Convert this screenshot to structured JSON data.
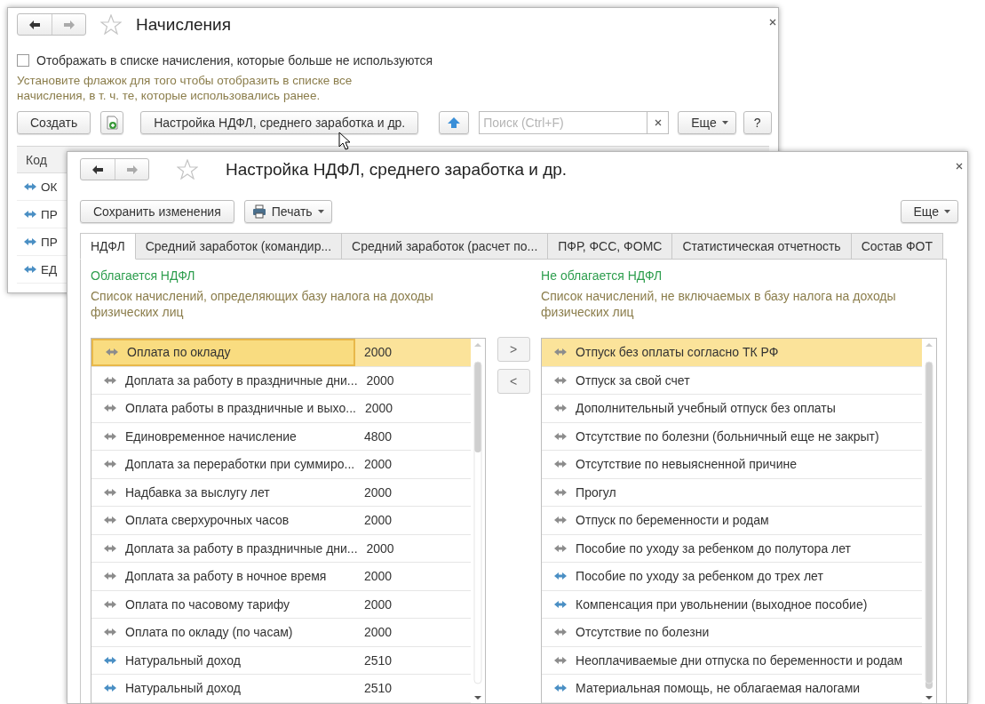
{
  "back_window": {
    "title": "Начисления",
    "show_unused": {
      "label": "Отображать в списке начисления, которые больше не используются",
      "checked": false
    },
    "hint": "Установите флажок для того чтобы отобразить в списке все начисления, в т. ч. те, которые использовались ранее.",
    "create_button": "Создать",
    "settings_button": "Настройка НДФЛ, среднего заработка и др.",
    "search": {
      "placeholder": "Поиск (Ctrl+F)"
    },
    "more_button": "Еще",
    "help_button": "?",
    "list": {
      "columns": [
        "Код"
      ],
      "rows": [
        {
          "code": "ОК",
          "color": "#4a8fc4"
        },
        {
          "code": "ПР",
          "color": "#4a8fc4"
        },
        {
          "code": "ПР",
          "color": "#4a8fc4"
        },
        {
          "code": "ЕД",
          "color": "#4a8fc4"
        }
      ]
    }
  },
  "settings_window": {
    "title": "Настройка НДФЛ, среднего заработка и др.",
    "save_button": "Сохранить изменения",
    "print_button": "Печать",
    "more_button": "Еще",
    "tabs": [
      {
        "label": "НДФЛ",
        "selected": true
      },
      {
        "label": "Средний заработок (командир...",
        "selected": false
      },
      {
        "label": "Средний заработок (расчет по...",
        "selected": false
      },
      {
        "label": "ПФР, ФСС, ФОМС",
        "selected": false
      },
      {
        "label": "Статистическая отчетность",
        "selected": false
      },
      {
        "label": "Состав ФОТ",
        "selected": false
      }
    ],
    "taxed": {
      "heading": "Облагается НДФЛ",
      "description": "Список начислений, определяющих базу налога на доходы физических лиц",
      "rows": [
        {
          "name": "Оплата по окладу",
          "amount": "2000",
          "color": "#8c8c8c",
          "selected": true
        },
        {
          "name": "Доплата за работу в праздничные дни...",
          "amount": "2000",
          "color": "#8c8c8c",
          "selected": false
        },
        {
          "name": "Оплата работы в праздничные и выхо...",
          "amount": "2000",
          "color": "#8c8c8c",
          "selected": false
        },
        {
          "name": "Единовременное начисление",
          "amount": "4800",
          "color": "#8c8c8c",
          "selected": false
        },
        {
          "name": "Доплата за переработки при суммиро...",
          "amount": "2000",
          "color": "#8c8c8c",
          "selected": false
        },
        {
          "name": "Надбавка за выслугу лет",
          "amount": "2000",
          "color": "#8c8c8c",
          "selected": false
        },
        {
          "name": "Оплата сверхурочных часов",
          "amount": "2000",
          "color": "#8c8c8c",
          "selected": false
        },
        {
          "name": "Доплата за работу в праздничные дни...",
          "amount": "2000",
          "color": "#8c8c8c",
          "selected": false
        },
        {
          "name": "Доплата за работу в ночное время",
          "amount": "2000",
          "color": "#8c8c8c",
          "selected": false
        },
        {
          "name": "Оплата по часовому тарифу",
          "amount": "2000",
          "color": "#8c8c8c",
          "selected": false
        },
        {
          "name": "Оплата по окладу (по часам)",
          "amount": "2000",
          "color": "#8c8c8c",
          "selected": false
        },
        {
          "name": "Натуральный доход",
          "amount": "2510",
          "color": "#4a8fc4",
          "selected": false
        },
        {
          "name": "Натуральный доход",
          "amount": "2510",
          "color": "#4a8fc4",
          "selected": false
        }
      ]
    },
    "move_buttons": [
      ">",
      "<"
    ],
    "untaxed": {
      "heading": "Не облагается НДФЛ",
      "description": "Список начислений, не включаемых в базу налога на доходы физических лиц",
      "rows": [
        {
          "name": "Отпуск без оплаты согласно ТК РФ",
          "color": "#8c8c8c",
          "selected": true
        },
        {
          "name": "Отпуск за свой счет",
          "color": "#8c8c8c",
          "selected": false
        },
        {
          "name": "Дополнительный учебный отпуск без оплаты",
          "color": "#8c8c8c",
          "selected": false
        },
        {
          "name": "Отсутствие по болезни (больничный еще не закрыт)",
          "color": "#8c8c8c",
          "selected": false
        },
        {
          "name": "Отсутствие по невыясненной причине",
          "color": "#8c8c8c",
          "selected": false
        },
        {
          "name": "Прогул",
          "color": "#8c8c8c",
          "selected": false
        },
        {
          "name": "Отпуск по беременности и родам",
          "color": "#8c8c8c",
          "selected": false
        },
        {
          "name": "Пособие по уходу за ребенком до полутора лет",
          "color": "#8c8c8c",
          "selected": false
        },
        {
          "name": "Пособие по уходу за ребенком до трех лет",
          "color": "#4a8fc4",
          "selected": false
        },
        {
          "name": "Компенсация при увольнении (выходное пособие)",
          "color": "#4a8fc4",
          "selected": false
        },
        {
          "name": "Отсутствие по болезни",
          "color": "#8c8c8c",
          "selected": false
        },
        {
          "name": "Неоплачиваемые дни отпуска по беременности и родам",
          "color": "#8c8c8c",
          "selected": false
        },
        {
          "name": "Материальная помощь, не облагаемая налогами",
          "color": "#4a8fc4",
          "selected": false
        }
      ]
    }
  }
}
